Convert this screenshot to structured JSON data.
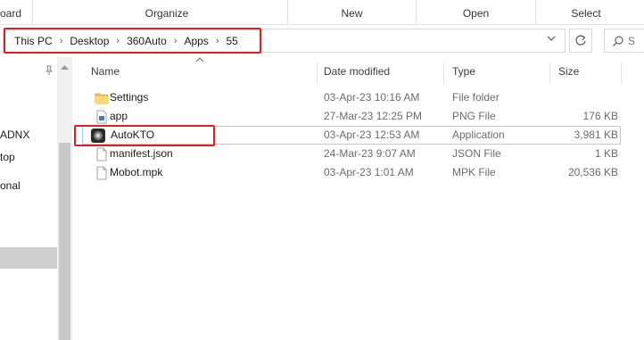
{
  "ribbon": {
    "groups": [
      "oard",
      "Organize",
      "New",
      "Open",
      "Select"
    ]
  },
  "address": {
    "crumbs": [
      "This PC",
      "Desktop",
      "360Auto",
      "Apps",
      "55"
    ],
    "search_placeholder": "S"
  },
  "nav": {
    "items": [
      "ADNX",
      "top",
      "onal"
    ]
  },
  "columns": {
    "name": "Name",
    "date": "Date modified",
    "type": "Type",
    "size": "Size"
  },
  "files": [
    {
      "name": "Settings",
      "date": "03-Apr-23 10:16 AM",
      "type": "File folder",
      "size": "",
      "icon": "folder-icon"
    },
    {
      "name": "app",
      "date": "27-Mar-23 12:25 PM",
      "type": "PNG File",
      "size": "176 KB",
      "icon": "image-file-icon"
    },
    {
      "name": "AutoKTO",
      "date": "03-Apr-23 12:53 AM",
      "type": "Application",
      "size": "3,981 KB",
      "icon": "application-icon"
    },
    {
      "name": "manifest.json",
      "date": "24-Mar-23 9:07 AM",
      "type": "JSON File",
      "size": "1 KB",
      "icon": "document-icon"
    },
    {
      "name": "Mobot.mpk",
      "date": "03-Apr-23 1:01 AM",
      "type": "MPK File",
      "size": "20,536 KB",
      "icon": "document-icon"
    }
  ],
  "colors": {
    "highlight_red": "#e02020",
    "selection_border": "#99d1ff",
    "folder_yellow": "#f5c74e"
  }
}
